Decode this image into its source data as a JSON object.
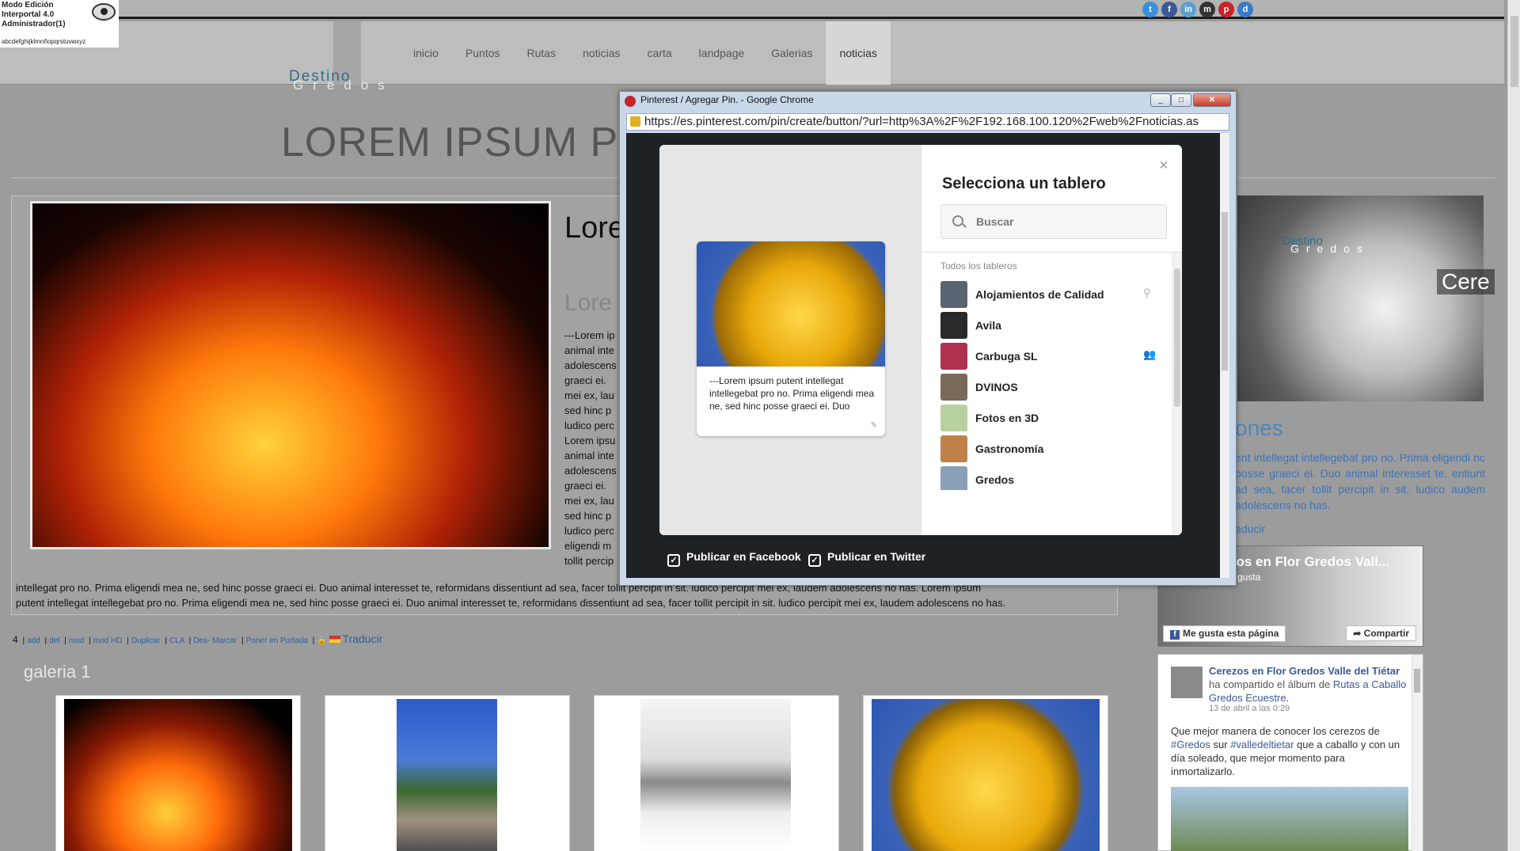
{
  "admin": {
    "line1": "Modo Edición",
    "line2": "Interportal 4.0",
    "line3": "Administrador(1)",
    "alphabet": "abcdefghijklmnñopqrstuvwxyz"
  },
  "social_icons": [
    "twitter-icon",
    "facebook-icon",
    "linkedin-icon",
    "myspace-icon",
    "pinterest-icon",
    "delicious-icon"
  ],
  "nav": {
    "items": [
      "inicio",
      "Puntos",
      "Rutas",
      "noticias",
      "carta",
      "landpage",
      "Galerias",
      "noticias"
    ],
    "active_index": 7
  },
  "logo": {
    "word1": "Destino",
    "word2": "Gredos"
  },
  "page": {
    "title": "LOREM IPSUM PUTEN",
    "article_title": "Lore pro n",
    "article_subtitle": "Lore",
    "article_column": "---Lorem ip animal inte adolescens graeci ei. mei ex, lau sed hinc p ludico perc Lorem ipsu animal inte adolescens graeci ei. mei ex, lau sed hinc p ludico perc eligendi m tollit percip",
    "article_wide_1": "intellegat pro no. Prima eligendi mea ne, sed hinc posse graeci ei. Duo animal interesset te, reformidans dissentiunt ad sea, facer tollit percipit in sit. ludico percipit mei ex, laudem adolescens no has. Lorem ipsum",
    "article_wide_2": "putent intellegat intellegebat pro no. Prima eligendi mea ne, sed hinc posse graeci ei. Duo animal interesset te, reformidans dissentiunt ad sea, facer tollit percipit in sit. ludico percipit mei ex, laudem adolescens no has."
  },
  "toolbar": {
    "count": "4",
    "links": [
      "add",
      "del",
      "mod",
      "mod HD",
      "Duplicar",
      "CLA",
      "Des- Marcar",
      "Poner en Portada"
    ],
    "translate": "Traducir"
  },
  "gallery": {
    "title": "galeria 1"
  },
  "sidebar": {
    "logo1": "Destino",
    "logo2": "Gredos",
    "overlay": "Cere",
    "heading": "ones",
    "text": "ent intellegat intellegebat pro no. Prima eligendi nc posse graeci ei. Duo animal interesset te, entiunt ad sea, facer tollit percipit in sit. ludico audem adolescens no has.",
    "link": "aducir",
    "fb_page_title": "zos en Flor Gredos Vall...",
    "fb_page_sub": "gusta",
    "fb_like": "Me gusta esta página",
    "fb_share": "Compartir",
    "feed_author": "Cerezos en Flor Gredos Valle del Tiétar",
    "feed_action": "ha compartido el álbum de",
    "feed_album": "Rutas a Caballo Gredos Ecuestre",
    "feed_date": "13 de abril a las 0:29",
    "feed_msg_1": "Que mejor manera de conocer los cerezos de",
    "feed_tag_1": "#Gredos",
    "feed_msg_2": "sur",
    "feed_tag_2": "#valledeltietar",
    "feed_msg_3": "que a caballo y con un día soleado, que mejor momento para inmortalizarlo."
  },
  "popup": {
    "window_title": "Pinterest / Agregar Pin. - Google Chrome",
    "url": "https://es.pinterest.com/pin/create/button/?url=http%3A%2F%2F192.168.100.120%2Fweb%2Fnoticias.as",
    "pin_text": "---Lorem ipsum putent intellegat intellegebat pro no. Prima eligendi mea ne, sed hinc posse graeci ei. Duo",
    "board_title": "Selecciona un tablero",
    "search_placeholder": "Buscar",
    "all_boards": "Todos los tableros",
    "boards": [
      {
        "name": "Alojamientos de Calidad",
        "icon": "location-pin-icon",
        "color": "#5a6470"
      },
      {
        "name": "Avila",
        "icon": "",
        "color": "#2a2a2a"
      },
      {
        "name": "Carbuga SL",
        "icon": "group-icon",
        "color": "#b03050"
      },
      {
        "name": "DVINOS",
        "icon": "",
        "color": "#7a6a5a"
      },
      {
        "name": "Fotos en 3D",
        "icon": "",
        "color": "#b8d0a0"
      },
      {
        "name": "Gastronomía",
        "icon": "",
        "color": "#c08048"
      },
      {
        "name": "Gredos",
        "icon": "",
        "color": "#8aa0b8"
      }
    ],
    "publish_facebook": "Publicar en Facebook",
    "publish_twitter": "Publicar en Twitter"
  }
}
